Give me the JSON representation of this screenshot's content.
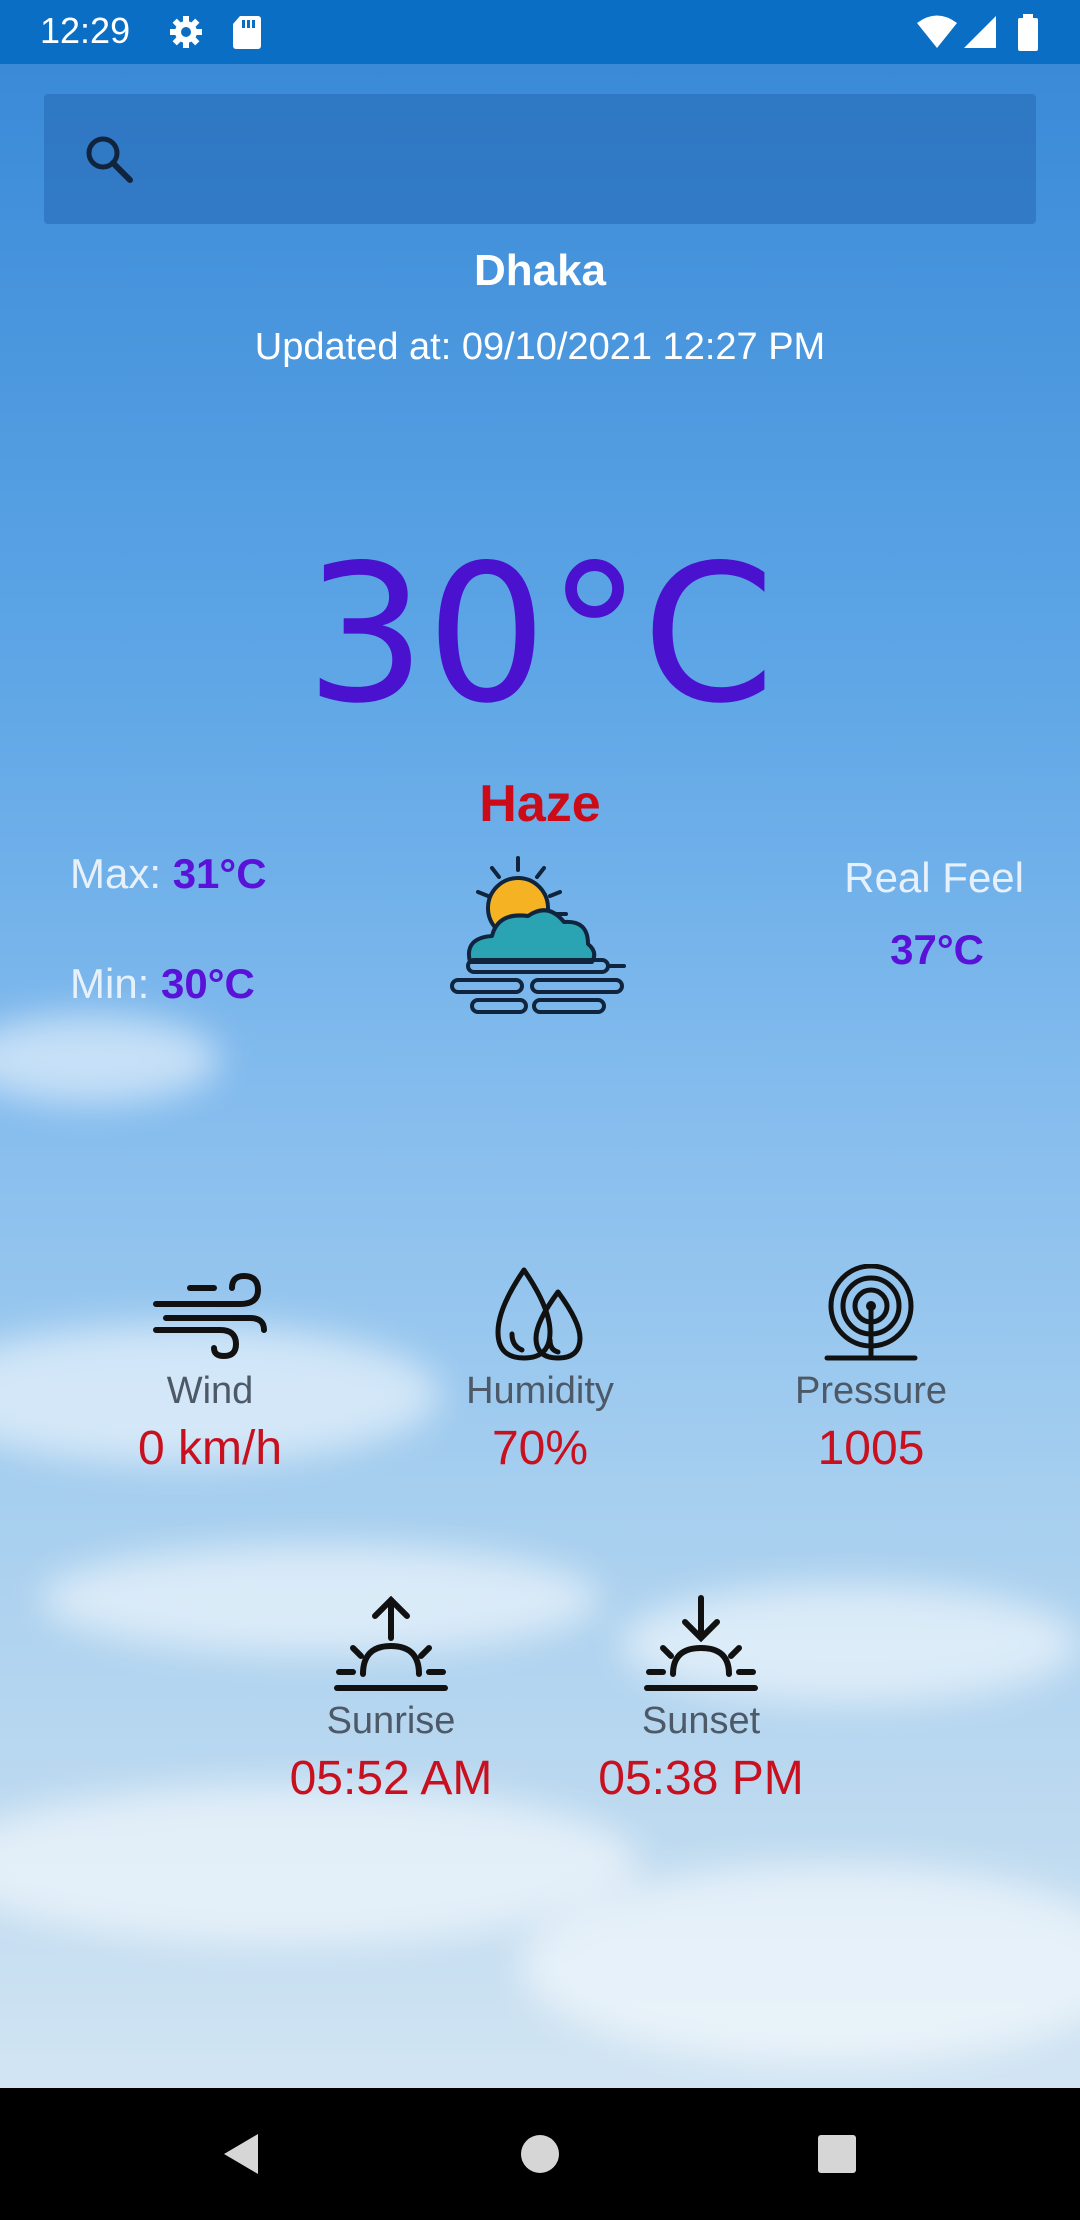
{
  "status_bar": {
    "time": "12:29",
    "icons": [
      "settings-icon",
      "sd-card-icon",
      "wifi-icon",
      "signal-icon",
      "battery-icon"
    ]
  },
  "search": {
    "placeholder": "",
    "value": ""
  },
  "city": "Dhaka",
  "updated": "Updated at: 09/10/2021 12:27 PM",
  "temperature": "30°C",
  "condition": "Haze",
  "min_max": {
    "max_label": "Max: ",
    "max_value": "31°C",
    "min_label": "Min: ",
    "min_value": "30°C"
  },
  "real_feel": {
    "label": "Real Feel",
    "value": "37°C"
  },
  "details": {
    "wind": {
      "label": "Wind",
      "value": "0 km/h",
      "icon": "wind-icon"
    },
    "humidity": {
      "label": "Humidity",
      "value": "70%",
      "icon": "humidity-icon"
    },
    "pressure": {
      "label": "Pressure",
      "value": "1005",
      "icon": "pressure-icon"
    },
    "sunrise": {
      "label": "Sunrise",
      "value": "05:52 AM",
      "icon": "sunrise-icon"
    },
    "sunset": {
      "label": "Sunset",
      "value": "05:38 PM",
      "icon": "sunset-icon"
    }
  },
  "nav": [
    "back-icon",
    "home-icon",
    "recents-icon"
  ],
  "colors": {
    "status_bar": "#0a6fc4",
    "temperature": "#4a12cf",
    "condition": "#cc0b18",
    "accent_value": "#5a12d9",
    "detail_value": "#c8101e"
  }
}
